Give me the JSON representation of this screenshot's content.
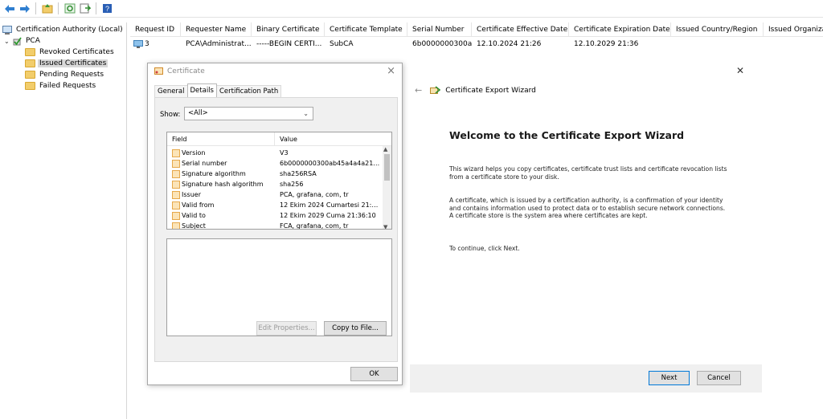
{
  "toolbar": {
    "buttons": [
      "back-icon",
      "forward-icon",
      "up-folder-icon",
      "refresh-icon",
      "export-list-icon",
      "help-icon"
    ]
  },
  "tree": {
    "root": "Certification Authority (Local)",
    "ca": "PCA",
    "items": [
      "Revoked Certificates",
      "Issued Certificates",
      "Pending Requests",
      "Failed Requests"
    ],
    "selected": "Issued Certificates"
  },
  "list": {
    "columns": [
      "Request ID",
      "Requester Name",
      "Binary Certificate",
      "Certificate Template",
      "Serial Number",
      "Certificate Effective Date",
      "Certificate Expiration Date",
      "Issued Country/Region",
      "Issued Organizat"
    ],
    "rows": [
      {
        "request_id": "3",
        "requester": "PCA\\Administrat...",
        "binary": "-----BEGIN CERTI...",
        "template": "SubCA",
        "serial": "6b0000000300a...",
        "effective": "12.10.2024 21:26",
        "expiration": "12.10.2029 21:36"
      }
    ]
  },
  "cert_dialog": {
    "title": "Certificate",
    "tabs": [
      "General",
      "Details",
      "Certification Path"
    ],
    "active_tab": "Details",
    "show_label": "Show:",
    "show_value": "<All>",
    "field_header": "Field",
    "value_header": "Value",
    "fields": [
      {
        "name": "Version",
        "value": "V3"
      },
      {
        "name": "Serial number",
        "value": "6b0000000300ab45a4a4a21c..."
      },
      {
        "name": "Signature algorithm",
        "value": "sha256RSA"
      },
      {
        "name": "Signature hash algorithm",
        "value": "sha256"
      },
      {
        "name": "Issuer",
        "value": "PCA, grafana, com, tr"
      },
      {
        "name": "Valid from",
        "value": "12 Ekim 2024 Cumartesi 21:26..."
      },
      {
        "name": "Valid to",
        "value": "12 Ekim 2029 Cuma 21:36:10"
      },
      {
        "name": "Subject",
        "value": "FCA, grafana, com, tr"
      }
    ],
    "edit_properties": "Edit Properties...",
    "copy_to_file": "Copy to File...",
    "ok": "OK"
  },
  "wizard": {
    "title": "Certificate Export Wizard",
    "heading": "Welcome to the Certificate Export Wizard",
    "para1": "This wizard helps you copy certificates, certificate trust lists and certificate revocation lists from a certificate store to your disk.",
    "para2": "A certificate, which is issued by a certification authority, is a confirmation of your identity and contains information used to protect data or to establish secure network connections. A certificate store is the system area where certificates are kept.",
    "para3": "To continue, click Next.",
    "next": "Next",
    "cancel": "Cancel"
  }
}
